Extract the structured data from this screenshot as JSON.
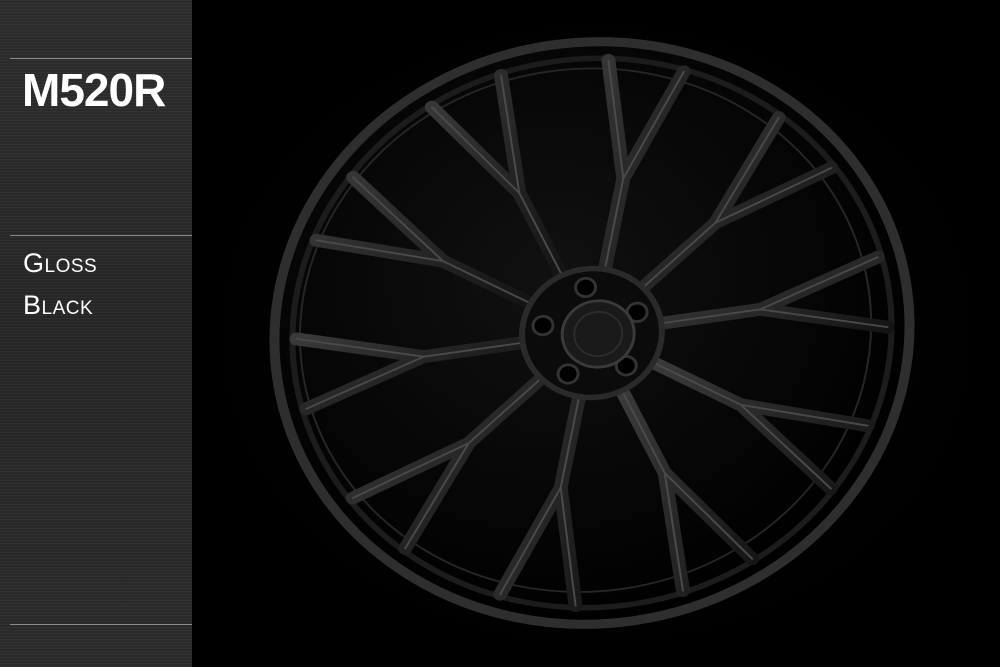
{
  "product": {
    "model": "M520R",
    "finish_line1": "Gloss",
    "finish_line2": "Black"
  },
  "image": {
    "subject": "wheel-photo",
    "colors": {
      "background": "#000000",
      "panel": "#2a2a2a",
      "text": "#ffffff",
      "divider": "#8a8a8a"
    }
  }
}
